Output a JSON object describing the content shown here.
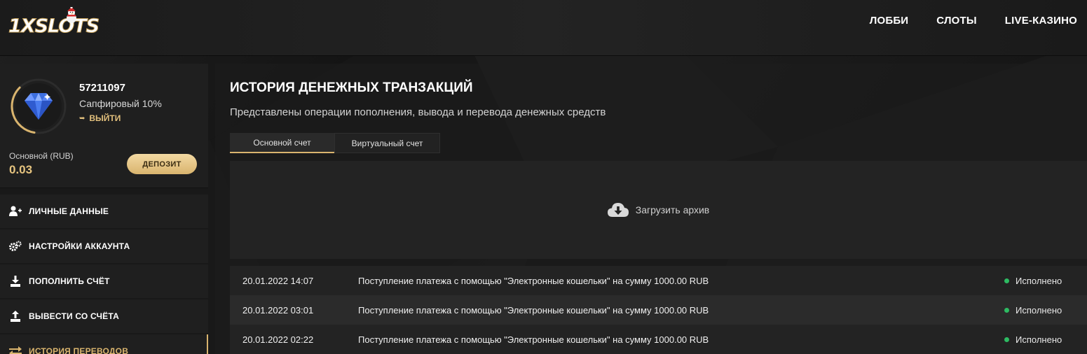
{
  "header": {
    "logo": "1XSLOTS",
    "nav": [
      "ЛОББИ",
      "СЛОТЫ",
      "LIVE-КАЗИНО"
    ]
  },
  "profile": {
    "user_id": "57211097",
    "level": "Сапфировый 10%",
    "logout": "ВЫЙТИ",
    "balance_label": "Основной (RUB)",
    "balance_value": "0.03",
    "deposit_label": "ДЕПОЗИТ",
    "level_progress": 0.35
  },
  "menu": [
    {
      "label": "ЛИЧНЫЕ ДАННЫЕ",
      "icon": "user-plus-icon"
    },
    {
      "label": "НАСТРОЙКИ АККАУНТА",
      "icon": "gears-icon"
    },
    {
      "label": "ПОПОЛНИТЬ СЧЁТ",
      "icon": "download-icon"
    },
    {
      "label": "ВЫВЕСТИ СО СЧЁТА",
      "icon": "upload-icon"
    },
    {
      "label": "ИСТОРИЯ ПЕРЕВОДОВ",
      "icon": "transfer-icon",
      "active": true
    }
  ],
  "main": {
    "title": "ИСТОРИЯ ДЕНЕЖНЫХ ТРАНЗАКЦИЙ",
    "subtitle": "Представлены операции пополнения, вывода и перевода денежных средств",
    "tabs": [
      "Основной счет",
      "Виртуальный счет"
    ],
    "archive_label": "Загрузить архив",
    "transactions": [
      {
        "date": "20.01.2022 14:07",
        "description": "Поступление платежа с помощью \"Электронные кошельки\" на сумму 1000.00 RUB",
        "status": "Исполнено"
      },
      {
        "date": "20.01.2022 03:01",
        "description": "Поступление платежа с помощью \"Электронные кошельки\" на сумму 1000.00 RUB",
        "status": "Исполнено"
      },
      {
        "date": "20.01.2022 02:22",
        "description": "Поступление платежа с помощью \"Электронные кошельки\" на сумму 1000.00 RUB",
        "status": "Исполнено"
      }
    ]
  },
  "colors": {
    "accent": "#d9b46e",
    "status_ok": "#2dbb62",
    "sapphire": "#3d6fe0"
  }
}
